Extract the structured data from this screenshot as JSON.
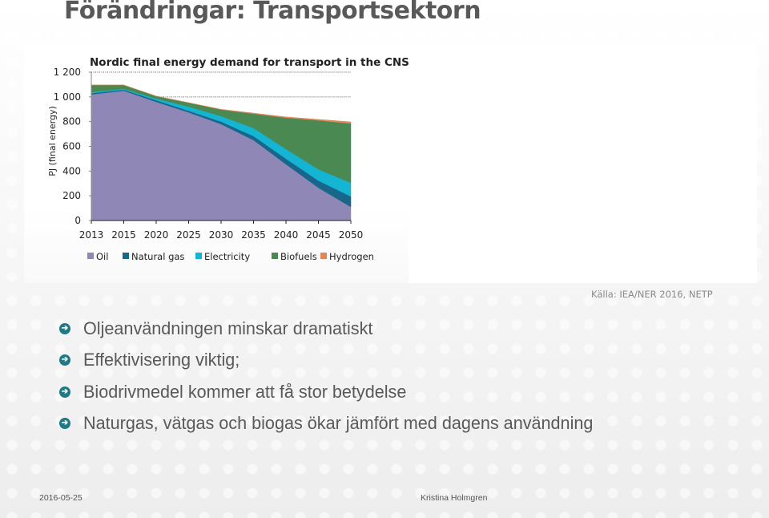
{
  "slide": {
    "title": "Förändringar: Transportsektorn",
    "source": "Källa: IEA/NER  2016, NETP",
    "bullets": [
      "Oljeanvändningen minskar dramatiskt",
      "Effektivisering viktig;",
      "Biodrivmedel kommer att få stor betydelse",
      "Naturgas, vätgas och biogas ökar jämfört med dagens användning"
    ],
    "bullet_icon": "arrow-right-circle-icon",
    "bullet_icon_glyph": "➔",
    "bullet_color": "#1f7a86",
    "footer": {
      "date": "2016-05-25",
      "author": "Kristina Holmgren"
    }
  },
  "chart_data": {
    "type": "area",
    "stacked": true,
    "title": "Nordic final energy demand for transport in the CNS",
    "xlabel": "",
    "ylabel": "PJ (final energy)",
    "x": [
      "2013",
      "2015",
      "2020",
      "2025",
      "2030",
      "2035",
      "2040",
      "2045",
      "2050"
    ],
    "ylim": [
      0,
      1200
    ],
    "yticks": [
      0,
      200,
      400,
      600,
      800,
      1000,
      1200
    ],
    "ytick_labels": [
      "0",
      "200",
      "400",
      "600",
      "800",
      "1 000",
      "1 200"
    ],
    "gridlines": [
      1000,
      1200
    ],
    "grid": "dotted-horizontal",
    "legend_position": "bottom",
    "series": [
      {
        "name": "Oil",
        "color": "#8f87b5",
        "values": [
          1020,
          1050,
          960,
          875,
          780,
          650,
          455,
          265,
          110
        ]
      },
      {
        "name": "Natural gas",
        "color": "#17678a",
        "values": [
          10,
          8,
          13,
          13,
          20,
          33,
          45,
          58,
          85
        ]
      },
      {
        "name": "Electricity",
        "color": "#14b4d3",
        "values": [
          8,
          8,
          13,
          33,
          45,
          65,
          78,
          91,
          110
        ]
      },
      {
        "name": "Biofuels",
        "color": "#4a8a52",
        "values": [
          58,
          30,
          20,
          32,
          52,
          116,
          253,
          396,
          480
        ]
      },
      {
        "name": "Hydrogen",
        "color": "#e0865a",
        "values": [
          0,
          0,
          0,
          0,
          3,
          5,
          7,
          8,
          13
        ]
      }
    ]
  }
}
